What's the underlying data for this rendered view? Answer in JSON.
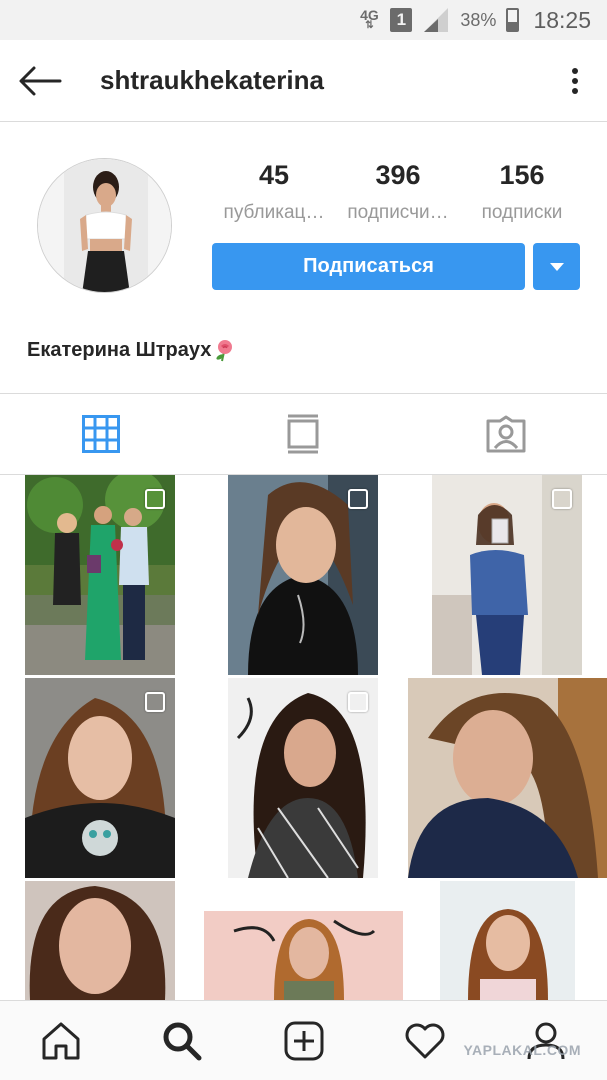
{
  "status_bar": {
    "network": "4G",
    "sim_slot": "1",
    "battery_percent": "38%",
    "battery_level": 0.38,
    "time": "18:25"
  },
  "header": {
    "username": "shtraukhekaterina",
    "back_icon": "arrow-left-icon",
    "menu_icon": "more-vertical-icon"
  },
  "profile": {
    "stats": [
      {
        "value": "45",
        "label": "публикац…"
      },
      {
        "value": "396",
        "label": "подписчи…"
      },
      {
        "value": "156",
        "label": "подписки"
      }
    ],
    "follow_label": "Подписаться",
    "full_name": "Екатерина Штраух",
    "name_emoji": "rose"
  },
  "tabs": [
    {
      "icon": "grid-icon",
      "active": true
    },
    {
      "icon": "feed-icon",
      "active": false
    },
    {
      "icon": "tagged-icon",
      "active": false
    }
  ],
  "grid": {
    "posts": [
      {
        "kind": "group-photo",
        "multi": true
      },
      {
        "kind": "selfie",
        "multi": true
      },
      {
        "kind": "mirror-selfie",
        "multi": true
      },
      {
        "kind": "selfie-curly",
        "multi": true
      },
      {
        "kind": "selfie-curly-dark",
        "multi": true
      },
      {
        "kind": "selfie-hoodie",
        "multi": false
      },
      {
        "kind": "portrait",
        "multi": false
      },
      {
        "kind": "wall-decal",
        "multi": false
      },
      {
        "kind": "portrait-light",
        "multi": false
      }
    ]
  },
  "bottom_nav": [
    {
      "icon": "home-icon"
    },
    {
      "icon": "search-icon"
    },
    {
      "icon": "add-post-icon"
    },
    {
      "icon": "heart-icon"
    },
    {
      "icon": "profile-icon"
    }
  ],
  "watermark": "YAPLAKAL.COM",
  "colors": {
    "accent": "#3897f0",
    "text": "#262626",
    "secondary_text": "#999999",
    "divider": "#dbdbdb",
    "status_bar_bg": "#f2f2f2"
  }
}
